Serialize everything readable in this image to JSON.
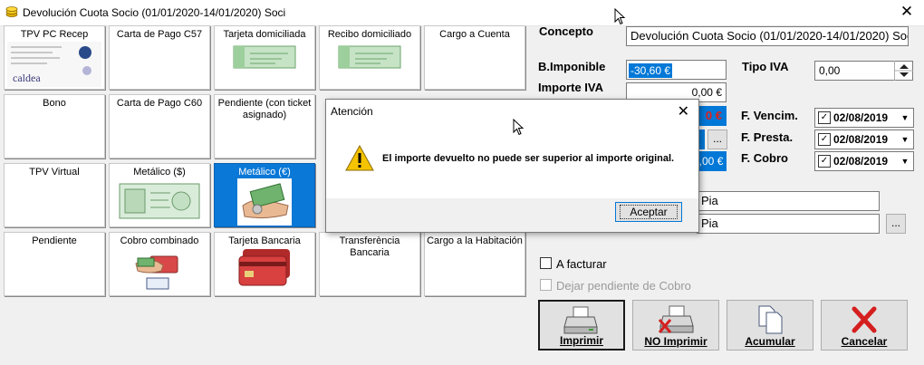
{
  "window": {
    "title": "Devolución Cuota Socio (01/01/2020-14/01/2020) Soci"
  },
  "tiles": [
    {
      "label": "TPV PC Recep",
      "icon": "tpv-pc-recep-icon",
      "row": 0,
      "col": 0,
      "logo": "caldea"
    },
    {
      "label": "Carta de Pago C57",
      "row": 0,
      "col": 1
    },
    {
      "label": "Tarjeta domiciliada",
      "icon": "cheque-icon",
      "row": 0,
      "col": 2
    },
    {
      "label": "Recibo domiciliado",
      "icon": "cheque-icon",
      "row": 0,
      "col": 3
    },
    {
      "label": "Cargo a Cuenta",
      "row": 0,
      "col": 4
    },
    {
      "label": "Bono",
      "row": 1,
      "col": 0
    },
    {
      "label": "Carta de Pago C60",
      "row": 1,
      "col": 1
    },
    {
      "label": "Pendiente (con ticket asignado)",
      "row": 1,
      "col": 2
    },
    {
      "label": "TPV Virtual",
      "row": 2,
      "col": 0
    },
    {
      "label": "Metálico ($)",
      "icon": "banknote-icon",
      "row": 2,
      "col": 1
    },
    {
      "label": "Metálico (€)",
      "icon": "money-hand-icon",
      "row": 2,
      "col": 2,
      "selected": true
    },
    {
      "label": "Pendiente",
      "row": 3,
      "col": 0
    },
    {
      "label": "Cobro combinado",
      "icon": "combined-payment-icon",
      "row": 3,
      "col": 1
    },
    {
      "label": "Tarjeta Bancaria",
      "icon": "credit-card-icon",
      "row": 3,
      "col": 2
    },
    {
      "label": "Transferència Bancaria",
      "row": 3,
      "col": 3
    },
    {
      "label": "Cargo a la Habitación",
      "row": 3,
      "col": 4
    }
  ],
  "form": {
    "concepto_label": "Concepto",
    "concepto_value": "Devolución Cuota Socio (01/01/2020-14/01/2020) Soc",
    "base_label": "B.Imponible",
    "base_value": "-30,60 €",
    "tipo_iva_label": "Tipo IVA",
    "tipo_iva_value": "0,00",
    "importe_iva_label": "Importe IVA",
    "importe_iva_value": "0,00 €",
    "partial_total": "0 €",
    "partial_total2": "0,00 €",
    "vencim_label": "F. Vencim.",
    "vencim_value": "02/08/2019",
    "presta_label": "F. Presta.",
    "presta_value": "02/08/2019",
    "cobro_label": "F. Cobro",
    "cobro_value": "02/08/2019",
    "name1": "Pia",
    "name2": "Pia",
    "ellipsis": "...",
    "a_facturar_label": "A facturar",
    "dejar_label": "Dejar pendiente  de Cobro"
  },
  "buttons": {
    "imprimir": "Imprimir",
    "no_imprimir": "NO Imprimir",
    "acumular": "Acumular",
    "cancelar": "Cancelar"
  },
  "dialog": {
    "title": "Atención",
    "message": "El importe devuelto no puede ser superior al importe original.",
    "ok": "Aceptar"
  },
  "colors": {
    "selected_tile": "#0a78d7",
    "amount_red": "#e0201b",
    "dialog_accent": "#0078d7"
  }
}
